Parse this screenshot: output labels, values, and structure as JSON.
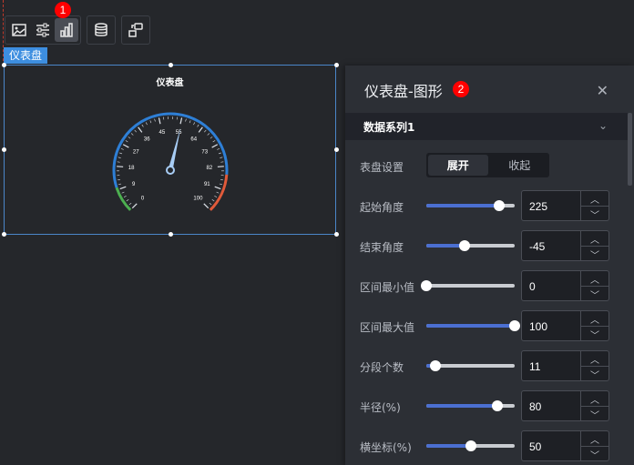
{
  "toolbar": {
    "group_icons": [
      "image-icon",
      "sliders-icon",
      "bar-chart-icon"
    ],
    "single_icons": [
      "database-icon",
      "link-icon"
    ],
    "badge": "1"
  },
  "widget": {
    "tag": "仪表盘",
    "title": "仪表盘",
    "gauge": {
      "tick_labels": [
        "0",
        "9",
        "18",
        "27",
        "36",
        "45",
        "55",
        "64",
        "73",
        "82",
        "91",
        "100"
      ],
      "value": 55,
      "min": 0,
      "max": 100,
      "start_angle": 225,
      "end_angle": -45,
      "colors": {
        "low": "#4caf50",
        "mid": "#2e7fd6",
        "high": "#e05a3a"
      }
    }
  },
  "panel": {
    "title": "仪表盘-图形",
    "badge": "2",
    "section": "数据系列1",
    "dial": {
      "label": "表盘设置",
      "options": [
        "展开",
        "收起"
      ],
      "selected": "展开"
    },
    "settings": [
      {
        "label": "起始角度",
        "value": "225",
        "fraction": 0.82
      },
      {
        "label": "结束角度",
        "value": "-45",
        "fraction": 0.43
      },
      {
        "label": "区间最小值",
        "value": "0",
        "fraction": 0.0
      },
      {
        "label": "区间最大值",
        "value": "100",
        "fraction": 1.0
      },
      {
        "label": "分段个数",
        "value": "11",
        "fraction": 0.1
      },
      {
        "label": "半径(%)",
        "value": "80",
        "fraction": 0.8
      },
      {
        "label": "横坐标(%)",
        "value": "50",
        "fraction": 0.5
      }
    ]
  }
}
